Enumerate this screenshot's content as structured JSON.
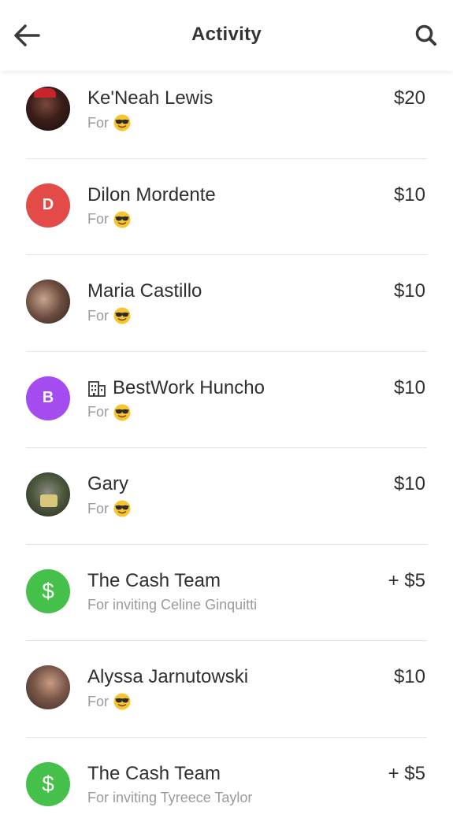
{
  "header": {
    "title": "Activity",
    "back_icon": "arrow-left-icon",
    "search_icon": "search-icon"
  },
  "colors": {
    "cash_green": "#45c04b",
    "avatar_red": "#e24b47",
    "avatar_purple": "#a44cf0"
  },
  "activity": [
    {
      "name": "Ke'Neah Lewis",
      "sub": "For",
      "emoji": "smiling-face-with-sunglasses",
      "amount": "$20",
      "avatar": "photo"
    },
    {
      "name": "Dilon Mordente",
      "sub": "For",
      "emoji": "smiling-face-with-sunglasses",
      "amount": "$10",
      "avatar": "D"
    },
    {
      "name": "Maria Castillo",
      "sub": "For",
      "emoji": "smiling-face-with-sunglasses",
      "amount": "$10",
      "avatar": "photo"
    },
    {
      "name": "BestWork Huncho",
      "sub": "For",
      "emoji": "smiling-face-with-sunglasses",
      "amount": "$10",
      "avatar": "B",
      "business_icon": "building-icon"
    },
    {
      "name": "Gary",
      "sub": "For",
      "emoji": "smiling-face-with-sunglasses",
      "amount": "$10",
      "avatar": "photo"
    },
    {
      "name": "The Cash Team",
      "sub": "For inviting Celine Ginquitti",
      "amount": "+ $5",
      "avatar": "$"
    },
    {
      "name": "Alyssa Jarnutowski",
      "sub": "For",
      "emoji": "smiling-face-with-sunglasses",
      "amount": "$10",
      "avatar": "photo"
    },
    {
      "name": "The Cash Team",
      "sub": "For inviting Tyreece Taylor",
      "amount": "+ $5",
      "avatar": "$"
    }
  ]
}
